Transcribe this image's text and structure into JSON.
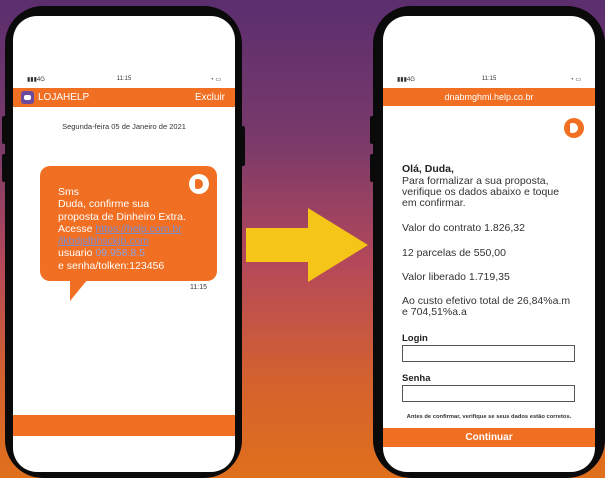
{
  "left_phone": {
    "status": {
      "signal": "4G",
      "time": "11:15"
    },
    "header": {
      "app_name": "LOJAHELP",
      "action": "Excluir"
    },
    "date": "Segunda-feira 05 de Janeiro de 2021",
    "message": {
      "line1": "Sms",
      "line2": "Duda, confirme sua",
      "line3": "proposta de Dinheiro Extra.",
      "acesse": "Acesse",
      "link1": "https://help.com.br",
      "link2": "/lkbdjsfbhsckjb.com",
      "usuario": "usuario",
      "user_value": "09.958.8.5",
      "senha": "e senha/tolken:123456",
      "time": "11:15"
    }
  },
  "right_phone": {
    "status": {
      "signal": "4G",
      "time": "11:15"
    },
    "url": "dnabmghml.help.co.br",
    "greeting": "Olá, Duda,",
    "intro": [
      "Para formalizar a sua proposta,",
      "verifique os dados abaixo e toque",
      "em confirmar."
    ],
    "valor_contrato": "Valor do contrato 1.826,32",
    "parcelas": "12 parcelas de 550,00",
    "valor_liberado": "Valor liberado 1.719,35",
    "custo": [
      "Ao custo efetivo total de 26,84%a.m",
      "e 704,51%a.a"
    ],
    "login_label": "Login",
    "senha_label": "Senha",
    "note": "Antes de confirmar, verifique se seus dados estão corretos.",
    "button": "Continuar"
  },
  "colors": {
    "accent": "#f06f22",
    "arrow": "#f5c518",
    "app_icon": "#6b4aa0"
  }
}
